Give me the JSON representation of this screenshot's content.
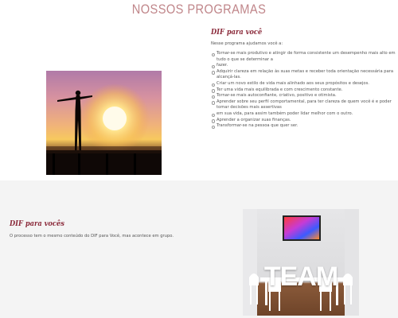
{
  "page": {
    "title": "NOSSOS PROGRAMAS"
  },
  "section1": {
    "heading": "DIF para você",
    "intro": "Nesse programa ajudamos você a:",
    "items": [
      "Tornar-se mais produtivo e atingir de forma consistente um desempenho mais alto em tudo o que se determinar a",
      "fazer.",
      "Adquirir clareza em relação às suas metas e receber toda orientação necessária para alcançá-las.",
      "Criar um novo estilo de vida mais alinhado aos seus propósitos e desejos.",
      "Ter uma vida mais equilibrada e com crescimento constante.",
      "Tornar-se mais autoconfiante, criativo, positivo e otimista.",
      "Aprender sobre seu perfil comportamental, para ter clareza de quem você é e poder tomar decisões mais assertivas",
      "em sua vida, para assim também poder lidar melhor com o outro.",
      "Aprender a organizar suas finanças.",
      "Transformar-se na pessoa que quer ser."
    ]
  },
  "section2": {
    "heading": "DIF para vocês",
    "text": "O processo tem o mesmo conteúdo do DIF para Você, mas acontece em grupo.",
    "image_word": "TEAM"
  },
  "colors": {
    "title": "#c0868a",
    "heading": "#8b2b3b",
    "section2_bg": "#f4f4f4"
  },
  "images": {
    "photo1": "silhouette-sunset-photo",
    "photo2": "team-meeting-room-photo"
  }
}
